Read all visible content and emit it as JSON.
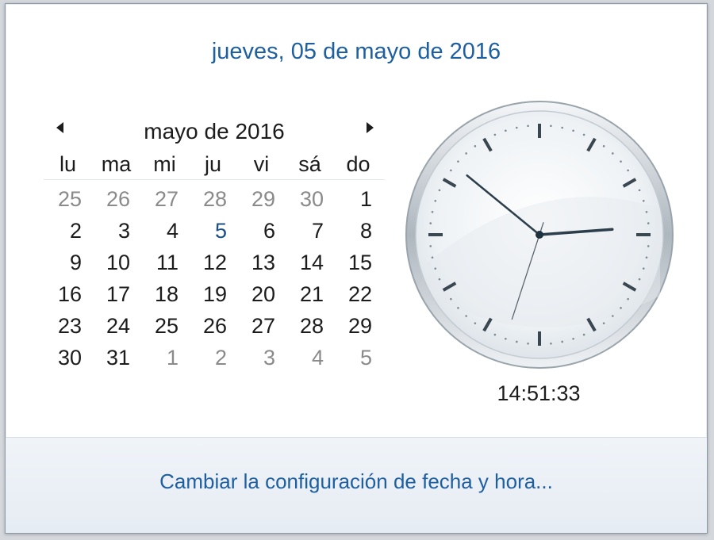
{
  "header": {
    "long_date": "jueves, 05 de mayo de 2016"
  },
  "calendar": {
    "month_label": "mayo de 2016",
    "weekdays": [
      "lu",
      "ma",
      "mi",
      "ju",
      "vi",
      "sá",
      "do"
    ],
    "days": [
      {
        "n": "25",
        "other": true
      },
      {
        "n": "26",
        "other": true
      },
      {
        "n": "27",
        "other": true
      },
      {
        "n": "28",
        "other": true
      },
      {
        "n": "29",
        "other": true
      },
      {
        "n": "30",
        "other": true
      },
      {
        "n": "1"
      },
      {
        "n": "2"
      },
      {
        "n": "3"
      },
      {
        "n": "4"
      },
      {
        "n": "5",
        "today": true
      },
      {
        "n": "6"
      },
      {
        "n": "7"
      },
      {
        "n": "8"
      },
      {
        "n": "9"
      },
      {
        "n": "10"
      },
      {
        "n": "11"
      },
      {
        "n": "12"
      },
      {
        "n": "13"
      },
      {
        "n": "14"
      },
      {
        "n": "15"
      },
      {
        "n": "16"
      },
      {
        "n": "17"
      },
      {
        "n": "18"
      },
      {
        "n": "19"
      },
      {
        "n": "20"
      },
      {
        "n": "21"
      },
      {
        "n": "22"
      },
      {
        "n": "23"
      },
      {
        "n": "24"
      },
      {
        "n": "25"
      },
      {
        "n": "26"
      },
      {
        "n": "27"
      },
      {
        "n": "28"
      },
      {
        "n": "29"
      },
      {
        "n": "30"
      },
      {
        "n": "31"
      },
      {
        "n": "1",
        "other": true
      },
      {
        "n": "2",
        "other": true
      },
      {
        "n": "3",
        "other": true
      },
      {
        "n": "4",
        "other": true
      },
      {
        "n": "5",
        "other": true
      }
    ],
    "prev_icon": "triangle-left-icon",
    "next_icon": "triangle-right-icon"
  },
  "clock": {
    "time_text": "14:51:33",
    "hours": 14,
    "minutes": 51,
    "seconds": 33
  },
  "footer": {
    "link_label": "Cambiar la configuración de fecha y hora..."
  },
  "colors": {
    "link": "#1e5fa0",
    "text": "#1c1c1c",
    "muted": "#8a8a8a",
    "hands": "#2c3e4c"
  }
}
